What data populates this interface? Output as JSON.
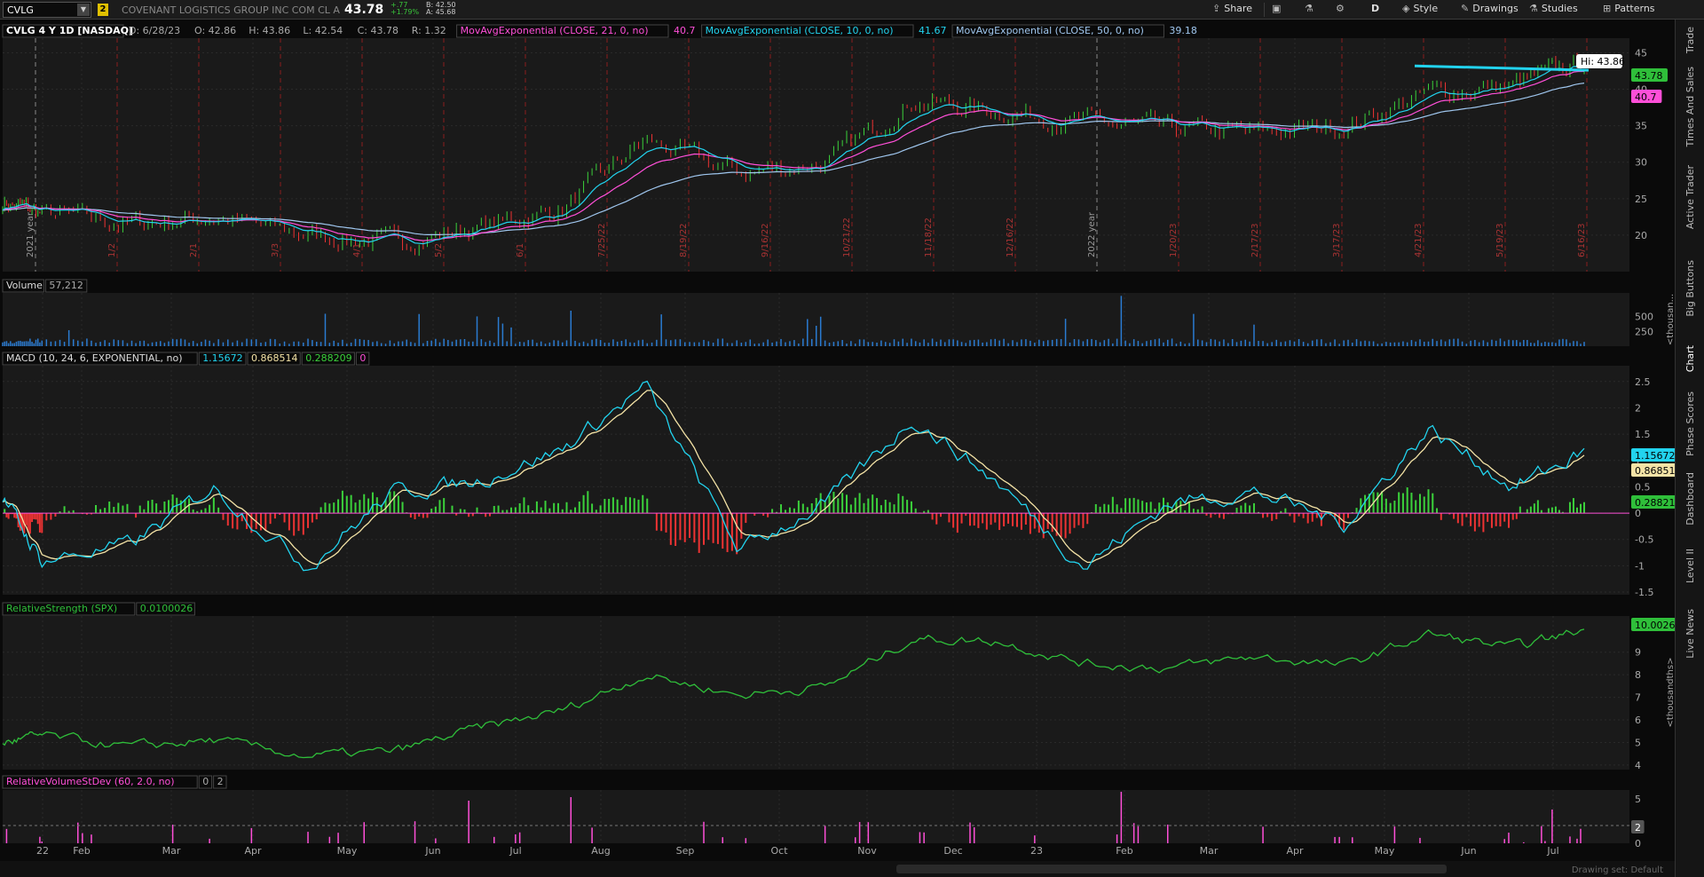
{
  "header": {
    "symbol": "CVLG",
    "link_badge": "2",
    "company": "COVENANT LOGISTICS GROUP INC COM CL A",
    "last": "43.78",
    "change": "+.77",
    "change_pct": "+1.79%",
    "bid": "B: 42.50",
    "ask": "A: 45.68"
  },
  "toolbar": {
    "share": "Share",
    "period": "D",
    "style": "Style",
    "drawings": "Drawings",
    "studies": "Studies",
    "patterns": "Patterns"
  },
  "price_panel": {
    "title": "CVLG 4 Y 1D [NASDAQ]",
    "bar": {
      "D": "D: 6/28/23",
      "O": "O: 42.86",
      "H": "H: 43.86",
      "L": "L: 42.54",
      "C": "C: 43.78",
      "R": "R: 1.32"
    },
    "studies": [
      {
        "label": "MovAvgExponential (CLOSE, 21, 0, no)",
        "value": "40.7",
        "color": "#ff4fd8"
      },
      {
        "label": "MovAvgExponential (CLOSE, 10, 0, no)",
        "value": "41.67",
        "color": "#22d3ee"
      },
      {
        "label": "MovAvgExponential (CLOSE, 50, 0, no)",
        "value": "39.18",
        "color": "#9fc6ee"
      }
    ],
    "hi_label": "Hi: 43.86",
    "last_tag": "43.78",
    "ema21_tag": "40.7",
    "ticks": [
      "45",
      "40",
      "35",
      "30",
      "25",
      "20"
    ],
    "date_markers": [
      "2021 year",
      "1/2",
      "2/1",
      "3/3",
      "4/1",
      "5/2",
      "6/1",
      "7/25/22",
      "8/19/22",
      "9/16/22",
      "10/21/22",
      "11/18/22",
      "12/16/22",
      "2022 year",
      "1/20/23",
      "2/17/23",
      "3/17/23",
      "4/21/23",
      "5/19/23",
      "6/16/23"
    ]
  },
  "volume_panel": {
    "label": "Volume",
    "value": "57,212",
    "ticks": [
      "500",
      "250"
    ],
    "unit": "<thousan..."
  },
  "macd_panel": {
    "label": "MACD (10, 24, 6, EXPONENTIAL, no)",
    "value": "1.15672",
    "avg": "0.868514",
    "diff": "0.288209",
    "zero": "0",
    "tags": {
      "value": "1.15672",
      "avg": "0.86851",
      "diff": "0.28821"
    },
    "ticks": [
      "2.5",
      "2",
      "1.5",
      "1",
      "0.5",
      "0",
      "-0.5",
      "-1",
      "-1.5"
    ]
  },
  "rs_panel": {
    "label": "RelativeStrength (SPX)",
    "value": "0.0100026",
    "tag": "10.0026",
    "ticks": [
      "9",
      "8",
      "7",
      "6",
      "5",
      "4"
    ],
    "unit": "<thousandths>"
  },
  "rv_panel": {
    "label": "RelativeVolumeStDev (60, 2.0, no)",
    "value1": "0",
    "value2": "2",
    "tag": "2",
    "ticks": [
      "5",
      "0"
    ]
  },
  "x_axis": [
    "22",
    "Feb",
    "Mar",
    "Apr",
    "May",
    "Jun",
    "Jul",
    "Aug",
    "Sep",
    "Oct",
    "Nov",
    "Dec",
    "23",
    "Feb",
    "Mar",
    "Apr",
    "May",
    "Jun",
    "Jul"
  ],
  "side_tabs": [
    "Trade",
    "Times And Sales",
    "Active Trader",
    "Big Buttons",
    "Chart",
    "Phase Scores",
    "Dashboard",
    "Level II",
    "Live News"
  ],
  "footer": {
    "drawing_set": "Drawing set: Default"
  },
  "chart_data": {
    "type": "line",
    "title": "CVLG 4 Y 1D [NASDAQ]",
    "x": [
      "Dec",
      "Jan",
      "Feb",
      "Mar",
      "Apr",
      "May",
      "Jun",
      "Jul",
      "Aug",
      "Sep",
      "Oct",
      "Nov",
      "Dec",
      "Jan",
      "Feb",
      "Mar",
      "Apr",
      "May",
      "Jun",
      "Jul"
    ],
    "series": [
      {
        "name": "CVLG",
        "values": [
          24.5,
          23.0,
          21.5,
          22.5,
          20.0,
          19.0,
          21.0,
          23.5,
          33.0,
          28.5,
          30.0,
          38.5,
          37.0,
          35.5,
          34.5,
          34.0,
          35.0,
          39.5,
          40.5,
          43.78
        ]
      },
      {
        "name": "MACD",
        "values": [
          0.3,
          -0.9,
          -0.6,
          0.5,
          -1.0,
          0.4,
          0.6,
          1.2,
          2.4,
          -0.7,
          0.2,
          1.8,
          0.6,
          -1.0,
          0.2,
          0.4,
          -0.2,
          1.6,
          0.5,
          1.15672
        ]
      },
      {
        "name": "RelativeStrength (SPX)",
        "values": [
          5.0,
          5.3,
          4.8,
          5.1,
          4.4,
          4.6,
          5.6,
          6.4,
          8.0,
          7.1,
          7.5,
          9.6,
          9.5,
          8.5,
          8.3,
          8.8,
          8.4,
          9.8,
          9.2,
          10.0026
        ]
      }
    ]
  }
}
